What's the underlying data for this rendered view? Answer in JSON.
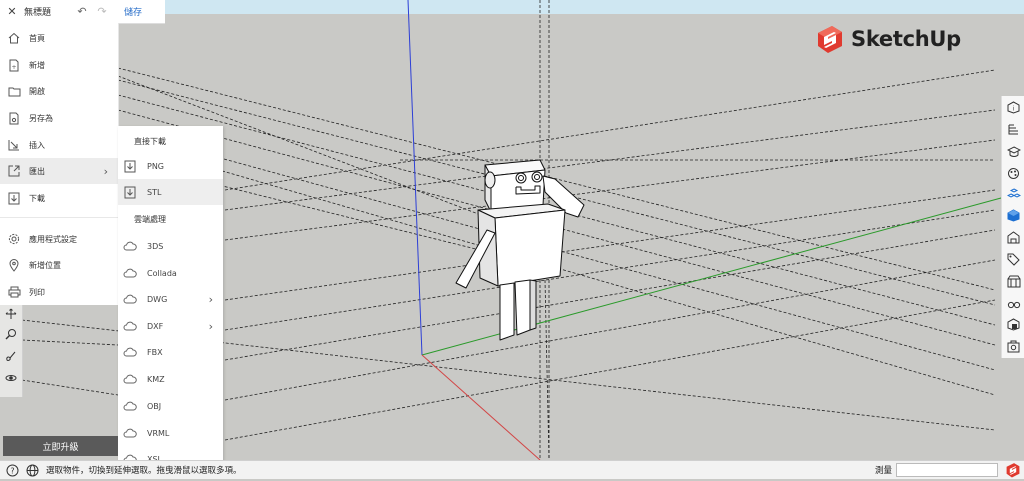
{
  "titlebar": {
    "close_icon": "close-icon",
    "title": "無標題",
    "undo_icon": "undo-icon",
    "redo_icon": "redo-icon",
    "save_label": "儲存"
  },
  "file_menu": {
    "items": [
      {
        "label": "首頁",
        "icon": "home-icon"
      },
      {
        "label": "新增",
        "icon": "new-file-icon"
      },
      {
        "label": "開啟",
        "icon": "folder-icon"
      },
      {
        "label": "另存為",
        "icon": "save-as-icon"
      },
      {
        "label": "插入",
        "icon": "insert-icon"
      },
      {
        "label": "匯出",
        "icon": "export-icon",
        "has_submenu": true,
        "active": true
      },
      {
        "label": "下載",
        "icon": "download-icon"
      },
      {
        "label": "應用程式設定",
        "icon": "gear-icon"
      },
      {
        "label": "新增位置",
        "icon": "location-pin-icon"
      },
      {
        "label": "列印",
        "icon": "printer-icon"
      }
    ]
  },
  "export_submenu": {
    "direct_header": "直接下載",
    "direct_items": [
      {
        "label": "PNG",
        "selected": false
      },
      {
        "label": "STL",
        "selected": true
      }
    ],
    "cloud_header": "雲端處理",
    "cloud_items": [
      {
        "label": "3DS",
        "has_submenu": false
      },
      {
        "label": "Collada",
        "has_submenu": false
      },
      {
        "label": "DWG",
        "has_submenu": true
      },
      {
        "label": "DXF",
        "has_submenu": true
      },
      {
        "label": "FBX",
        "has_submenu": false
      },
      {
        "label": "KMZ",
        "has_submenu": false
      },
      {
        "label": "OBJ",
        "has_submenu": false
      },
      {
        "label": "VRML",
        "has_submenu": false
      },
      {
        "label": "XSI",
        "has_submenu": false
      }
    ]
  },
  "upgrade_button": "立即升級",
  "brand": {
    "name": "SketchUp",
    "color": "#e03a2f"
  },
  "right_toolbar": [
    "entity-info-icon",
    "outliner-icon",
    "instructor-icon",
    "materials-icon",
    "components-icon",
    "styles-icon",
    "scenes-icon",
    "tags-icon",
    "shadows-icon",
    "glasses-icon",
    "solid-inspector-icon",
    "display-icon"
  ],
  "left_toolbar": [
    "move-icon",
    "search-icon",
    "paint-icon",
    "orbit-icon"
  ],
  "status_bar": {
    "help_icon": "help-icon",
    "globe_icon": "globe-icon",
    "message": "選取物件，切換到延伸選取。拖曳滑鼠以選取多項。",
    "measure_label": "測量",
    "measure_value": ""
  },
  "colors": {
    "axis_blue": "#2d3fd6",
    "axis_green": "#2a9a2a",
    "axis_red": "#d24646",
    "viewport_bg": "#c9c9c6"
  }
}
